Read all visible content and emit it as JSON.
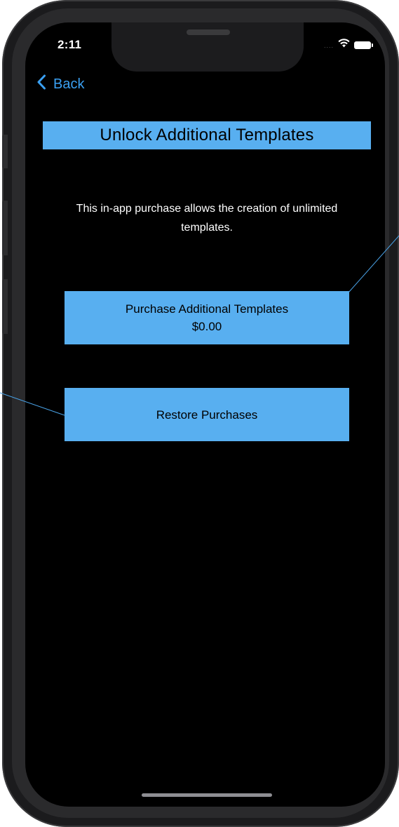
{
  "status_bar": {
    "time": "2:11",
    "signal": "....",
    "icons": [
      "wifi-icon",
      "battery-icon"
    ]
  },
  "nav": {
    "back_label": "Back",
    "back_icon": "chevron-left-icon"
  },
  "screen": {
    "title": "Unlock Additional Templates",
    "description": "This in-app purchase allows the creation of unlimited templates.",
    "buttons": [
      {
        "line1": "Purchase Additional Templates",
        "line2": "$0.00"
      },
      {
        "line1": "Restore Purchases"
      }
    ]
  },
  "colors": {
    "accent": "#58aff0",
    "link": "#3aa0f2",
    "background": "#000000"
  }
}
